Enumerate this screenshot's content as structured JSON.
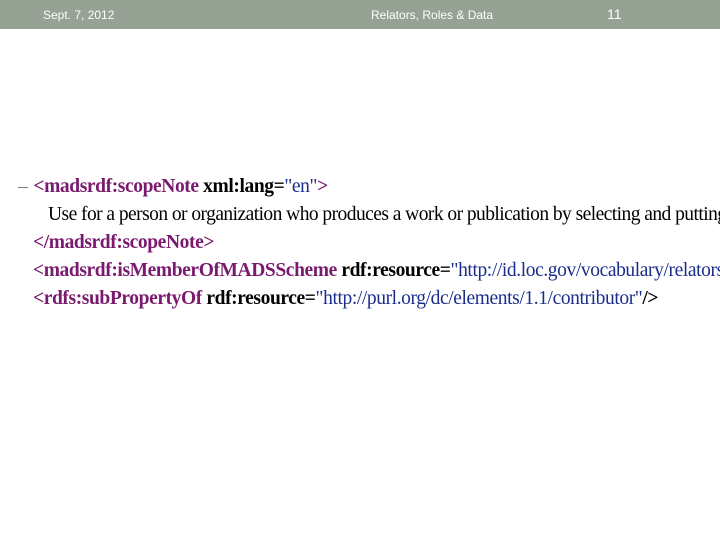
{
  "header": {
    "date": "Sept. 7, 2012",
    "title": "Relators, Roles & Data",
    "page_number": "11"
  },
  "xml": {
    "collapse_marker": "–",
    "line1": {
      "tag_open": "<madsrdf:scopeNote",
      "attr": " xml:lang=",
      "value": "\"en\"",
      "close": ">"
    },
    "line2": {
      "text": "Use for a person or organization who produces a work or publication by selecting and putting together :"
    },
    "line3": {
      "tag_close": "</madsrdf:scopeNote>"
    },
    "line4": {
      "tag_open": "<madsrdf:isMemberOfMADSScheme",
      "attr": " rdf:resource=",
      "value": "\"http://id.loc.gov/vocabulary/relators\"",
      "close": "/>"
    },
    "line5": {
      "tag_open": "<rdfs:subPropertyOf",
      "attr": " rdf:resource=",
      "value": "\"http://purl.org/dc/elements/1.1/contributor\"",
      "close": "/>"
    }
  }
}
